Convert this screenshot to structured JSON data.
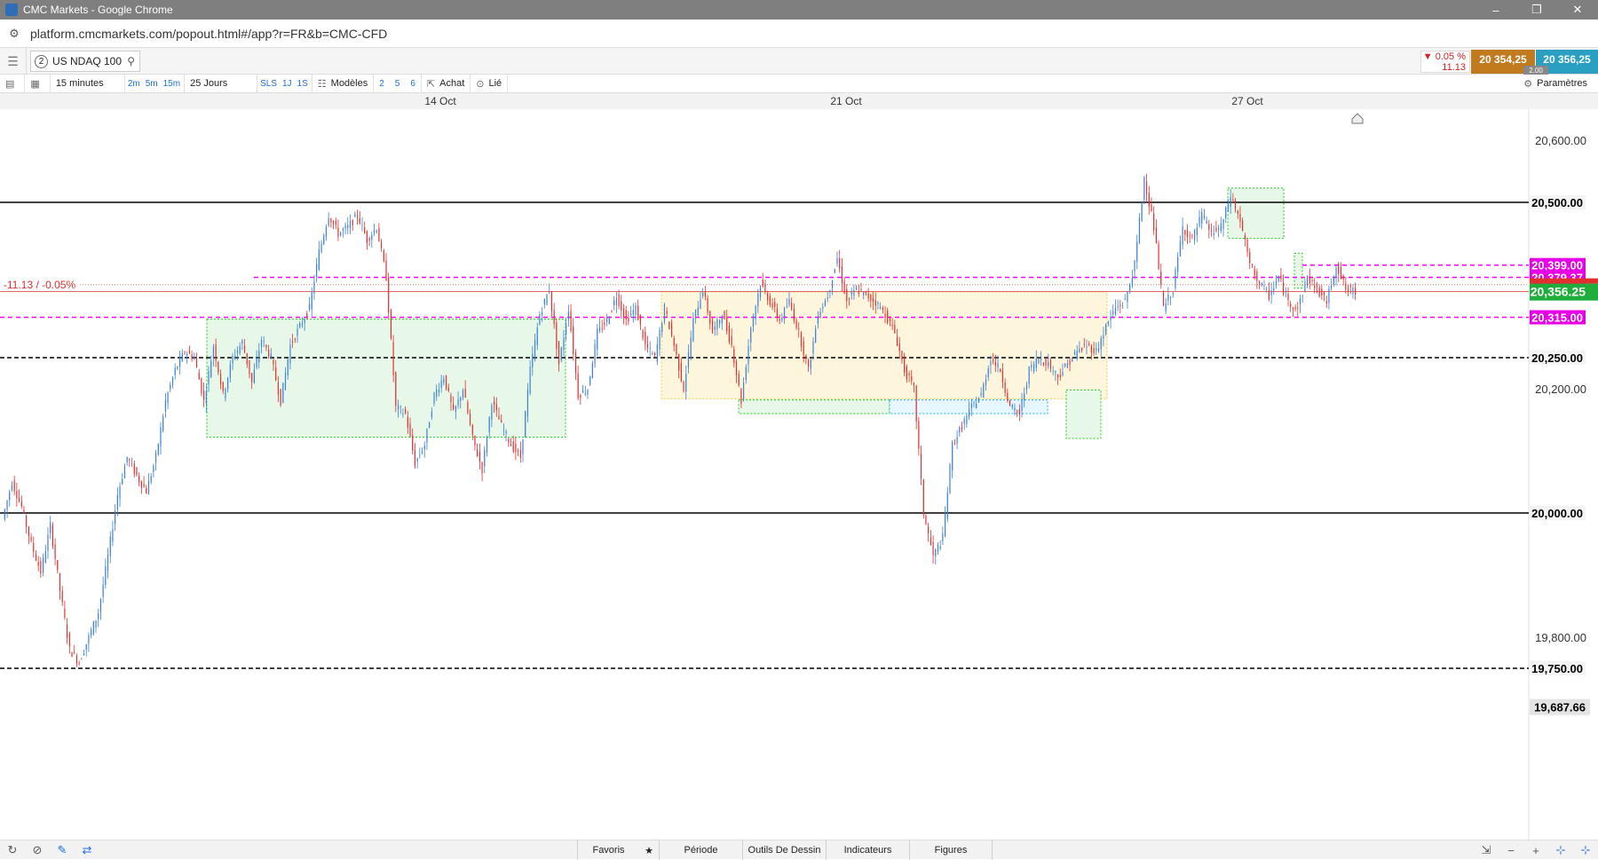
{
  "window": {
    "title": "CMC Markets - Google Chrome",
    "controls": [
      "–",
      "❐",
      "✕"
    ]
  },
  "address": {
    "url": "platform.cmcmarkets.com/popout.html#/app?r=FR&b=CMC-CFD"
  },
  "instrument": {
    "number": "2",
    "name": "US NDAQ 100"
  },
  "quote": {
    "change_pct": "▼ 0.05 %",
    "change_abs": "11.13",
    "sell": "20 354,25",
    "buy": "20 356,25",
    "spread": "2.00"
  },
  "toolbar": {
    "interval": "15 minutes",
    "quick_intervals": [
      "2m",
      "5m",
      "15m"
    ],
    "period": "25 Jours",
    "quick_periods": [
      "SLS",
      "1J",
      "1S"
    ],
    "templates_label": "Modèles",
    "template_slots": [
      "2",
      "5",
      "6"
    ],
    "order_label": "Achat",
    "link_label": "Lié",
    "settings_label": "Paramètres"
  },
  "chart_data": {
    "type": "candlestick",
    "instrument": "US NDAQ 100",
    "interval": "15 minutes",
    "period": "25 Jours",
    "x_ticks": [
      "14 Oct",
      "21 Oct",
      "27 Oct"
    ],
    "y_ticks": [
      "20,600.00",
      "20,200.00",
      "19,800.00"
    ],
    "ylim": [
      19650,
      20650
    ],
    "close_price": 20356.25,
    "close_label": "20,356.25",
    "change_label": "-11.13 / -0.05%",
    "low_label": "19,687.66",
    "price_path": [
      19990,
      20050,
      20010,
      19950,
      19905,
      19980,
      19875,
      19780,
      19760,
      19800,
      19840,
      19930,
      20030,
      20090,
      20060,
      20035,
      20090,
      20180,
      20230,
      20260,
      20250,
      20180,
      20270,
      20190,
      20250,
      20275,
      20210,
      20280,
      20250,
      20180,
      20270,
      20300,
      20330,
      20420,
      20480,
      20450,
      20460,
      20480,
      20440,
      20460,
      20380,
      20170,
      20160,
      20080,
      20110,
      20190,
      20220,
      20160,
      20200,
      20120,
      20070,
      20180,
      20140,
      20110,
      20090,
      20230,
      20320,
      20360,
      20240,
      20330,
      20190,
      20200,
      20290,
      20310,
      20350,
      20310,
      20330,
      20270,
      20250,
      20330,
      20270,
      20200,
      20310,
      20360,
      20290,
      20320,
      20270,
      20180,
      20300,
      20370,
      20340,
      20310,
      20340,
      20290,
      20230,
      20320,
      20350,
      20410,
      20340,
      20360,
      20350,
      20340,
      20320,
      20290,
      20230,
      20200,
      20000,
      19930,
      19960,
      20110,
      20140,
      20170,
      20190,
      20250,
      20230,
      20170,
      20160,
      20230,
      20250,
      20240,
      20220,
      20240,
      20260,
      20270,
      20260,
      20300,
      20330,
      20340,
      20400,
      20540,
      20460,
      20330,
      20360,
      20460,
      20440,
      20480,
      20450,
      20460,
      20510,
      20470,
      20400,
      20370,
      20350,
      20380,
      20340,
      20330,
      20380,
      20360,
      20340,
      20400,
      20360,
      20356
    ],
    "horizontal_levels": [
      {
        "label": "20,500.00",
        "price": 20500,
        "style": "solid",
        "color": "#000000"
      },
      {
        "label": "20,399.00",
        "price": 20399,
        "style": "dashed",
        "color": "#ff00ff"
      },
      {
        "label": "20,379.37",
        "price": 20379.37,
        "style": "dashed",
        "color": "#ff00ff"
      },
      {
        "label": "20,315.00",
        "price": 20315,
        "style": "dashed",
        "color": "#ff00ff"
      },
      {
        "label": "20,250.00",
        "price": 20250,
        "style": "dashed",
        "color": "#000000"
      },
      {
        "label": "20,000.00",
        "price": 20000,
        "style": "solid",
        "color": "#000000"
      },
      {
        "label": "19,750.00",
        "price": 19750,
        "style": "dashed",
        "color": "#000000"
      }
    ],
    "zones": [
      {
        "color": "#e8f8e8",
        "border": "#22cc22",
        "p_top": 20312,
        "p_bot": 20122
      },
      {
        "color": "#fdf6dc",
        "border": "#e8d040",
        "p_top": 20356,
        "p_bot": 20184
      },
      {
        "color": "#e8f8e8",
        "border": "#22cc22",
        "p_top": 20182,
        "p_bot": 20160
      },
      {
        "color": "#e6f7ff",
        "border": "#20a8e0",
        "p_top": 20182,
        "p_bot": 20160
      },
      {
        "color": "#e8f8e8",
        "border": "#22cc22",
        "p_top": 20198,
        "p_bot": 20120
      },
      {
        "color": "#e8f8e8",
        "border": "#22cc22",
        "p_top": 20523,
        "p_bot": 20442
      },
      {
        "color": "#e8f8e8",
        "border": "#22cc22",
        "p_top": 20418,
        "p_bot": 20362
      }
    ],
    "colors": {
      "up": "#3b7fd9",
      "down": "#e0302e",
      "close_badge": "#1fae3b",
      "magenta_badge": "#e600e6"
    }
  },
  "bottombar": {
    "tabs": [
      "Favoris",
      "★",
      "Période",
      "Outils De Dessin",
      "Indicateurs",
      "Figures"
    ],
    "left_tools": [
      "↻",
      "⊘",
      "✎",
      "⇄"
    ],
    "right_tools": [
      "⇲",
      "−",
      "+",
      "⊹",
      "⊹"
    ]
  }
}
